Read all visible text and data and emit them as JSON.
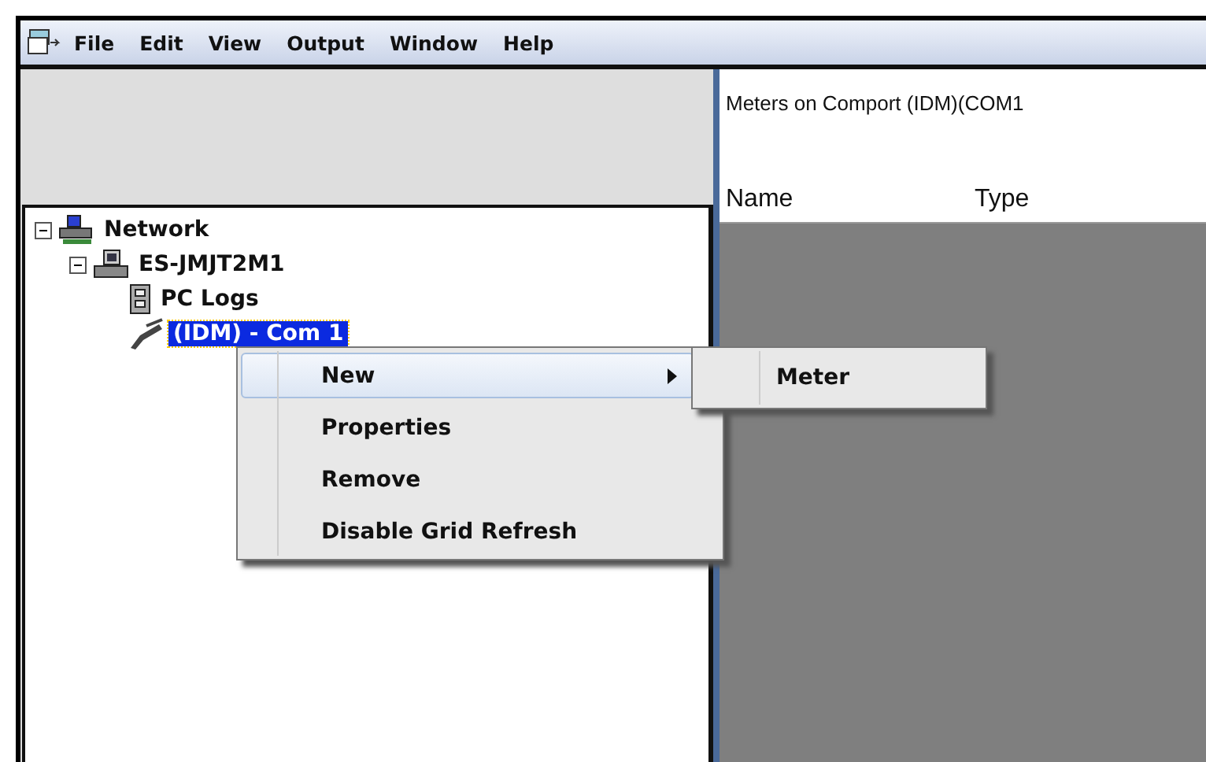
{
  "menu_bar": {
    "items": [
      {
        "label": "File"
      },
      {
        "label": "Edit"
      },
      {
        "label": "View"
      },
      {
        "label": "Output"
      },
      {
        "label": "Window"
      },
      {
        "label": "Help"
      }
    ]
  },
  "tree": [
    {
      "label": "Network",
      "kind": "network",
      "expanded": true,
      "selected": false,
      "children": [
        {
          "label": "ES-JMJT2M1",
          "kind": "computer",
          "expanded": true,
          "selected": false,
          "children": [
            {
              "label": "PC Logs",
              "kind": "logs",
              "selected": false
            },
            {
              "label": "(IDM) - Com 1",
              "kind": "comport",
              "selected": true
            }
          ]
        }
      ]
    }
  ],
  "right_pane": {
    "title": "Meters on Comport  (IDM)(COM1",
    "columns": [
      "Name",
      "Type"
    ]
  },
  "context_menu": {
    "items": [
      {
        "label": "New",
        "selected": true,
        "submenu": true
      },
      {
        "label": "Properties",
        "selected": false,
        "submenu": false
      },
      {
        "label": "Remove",
        "selected": false,
        "submenu": false
      },
      {
        "label": "Disable Grid Refresh",
        "selected": false,
        "submenu": false
      }
    ]
  },
  "submenu": {
    "items": [
      {
        "label": "Meter",
        "selected": false
      }
    ]
  }
}
